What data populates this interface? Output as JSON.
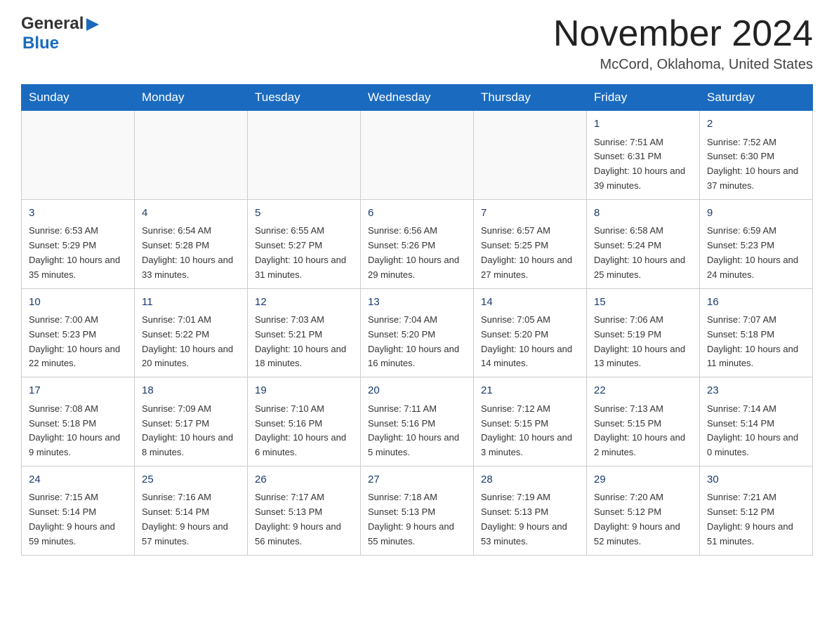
{
  "header": {
    "logo_general": "General",
    "logo_blue": "Blue",
    "title": "November 2024",
    "location": "McCord, Oklahoma, United States"
  },
  "days_of_week": [
    "Sunday",
    "Monday",
    "Tuesday",
    "Wednesday",
    "Thursday",
    "Friday",
    "Saturday"
  ],
  "weeks": [
    {
      "days": [
        {
          "number": "",
          "info": ""
        },
        {
          "number": "",
          "info": ""
        },
        {
          "number": "",
          "info": ""
        },
        {
          "number": "",
          "info": ""
        },
        {
          "number": "",
          "info": ""
        },
        {
          "number": "1",
          "info": "Sunrise: 7:51 AM\nSunset: 6:31 PM\nDaylight: 10 hours and 39 minutes."
        },
        {
          "number": "2",
          "info": "Sunrise: 7:52 AM\nSunset: 6:30 PM\nDaylight: 10 hours and 37 minutes."
        }
      ]
    },
    {
      "days": [
        {
          "number": "3",
          "info": "Sunrise: 6:53 AM\nSunset: 5:29 PM\nDaylight: 10 hours and 35 minutes."
        },
        {
          "number": "4",
          "info": "Sunrise: 6:54 AM\nSunset: 5:28 PM\nDaylight: 10 hours and 33 minutes."
        },
        {
          "number": "5",
          "info": "Sunrise: 6:55 AM\nSunset: 5:27 PM\nDaylight: 10 hours and 31 minutes."
        },
        {
          "number": "6",
          "info": "Sunrise: 6:56 AM\nSunset: 5:26 PM\nDaylight: 10 hours and 29 minutes."
        },
        {
          "number": "7",
          "info": "Sunrise: 6:57 AM\nSunset: 5:25 PM\nDaylight: 10 hours and 27 minutes."
        },
        {
          "number": "8",
          "info": "Sunrise: 6:58 AM\nSunset: 5:24 PM\nDaylight: 10 hours and 25 minutes."
        },
        {
          "number": "9",
          "info": "Sunrise: 6:59 AM\nSunset: 5:23 PM\nDaylight: 10 hours and 24 minutes."
        }
      ]
    },
    {
      "days": [
        {
          "number": "10",
          "info": "Sunrise: 7:00 AM\nSunset: 5:23 PM\nDaylight: 10 hours and 22 minutes."
        },
        {
          "number": "11",
          "info": "Sunrise: 7:01 AM\nSunset: 5:22 PM\nDaylight: 10 hours and 20 minutes."
        },
        {
          "number": "12",
          "info": "Sunrise: 7:03 AM\nSunset: 5:21 PM\nDaylight: 10 hours and 18 minutes."
        },
        {
          "number": "13",
          "info": "Sunrise: 7:04 AM\nSunset: 5:20 PM\nDaylight: 10 hours and 16 minutes."
        },
        {
          "number": "14",
          "info": "Sunrise: 7:05 AM\nSunset: 5:20 PM\nDaylight: 10 hours and 14 minutes."
        },
        {
          "number": "15",
          "info": "Sunrise: 7:06 AM\nSunset: 5:19 PM\nDaylight: 10 hours and 13 minutes."
        },
        {
          "number": "16",
          "info": "Sunrise: 7:07 AM\nSunset: 5:18 PM\nDaylight: 10 hours and 11 minutes."
        }
      ]
    },
    {
      "days": [
        {
          "number": "17",
          "info": "Sunrise: 7:08 AM\nSunset: 5:18 PM\nDaylight: 10 hours and 9 minutes."
        },
        {
          "number": "18",
          "info": "Sunrise: 7:09 AM\nSunset: 5:17 PM\nDaylight: 10 hours and 8 minutes."
        },
        {
          "number": "19",
          "info": "Sunrise: 7:10 AM\nSunset: 5:16 PM\nDaylight: 10 hours and 6 minutes."
        },
        {
          "number": "20",
          "info": "Sunrise: 7:11 AM\nSunset: 5:16 PM\nDaylight: 10 hours and 5 minutes."
        },
        {
          "number": "21",
          "info": "Sunrise: 7:12 AM\nSunset: 5:15 PM\nDaylight: 10 hours and 3 minutes."
        },
        {
          "number": "22",
          "info": "Sunrise: 7:13 AM\nSunset: 5:15 PM\nDaylight: 10 hours and 2 minutes."
        },
        {
          "number": "23",
          "info": "Sunrise: 7:14 AM\nSunset: 5:14 PM\nDaylight: 10 hours and 0 minutes."
        }
      ]
    },
    {
      "days": [
        {
          "number": "24",
          "info": "Sunrise: 7:15 AM\nSunset: 5:14 PM\nDaylight: 9 hours and 59 minutes."
        },
        {
          "number": "25",
          "info": "Sunrise: 7:16 AM\nSunset: 5:14 PM\nDaylight: 9 hours and 57 minutes."
        },
        {
          "number": "26",
          "info": "Sunrise: 7:17 AM\nSunset: 5:13 PM\nDaylight: 9 hours and 56 minutes."
        },
        {
          "number": "27",
          "info": "Sunrise: 7:18 AM\nSunset: 5:13 PM\nDaylight: 9 hours and 55 minutes."
        },
        {
          "number": "28",
          "info": "Sunrise: 7:19 AM\nSunset: 5:13 PM\nDaylight: 9 hours and 53 minutes."
        },
        {
          "number": "29",
          "info": "Sunrise: 7:20 AM\nSunset: 5:12 PM\nDaylight: 9 hours and 52 minutes."
        },
        {
          "number": "30",
          "info": "Sunrise: 7:21 AM\nSunset: 5:12 PM\nDaylight: 9 hours and 51 minutes."
        }
      ]
    }
  ]
}
